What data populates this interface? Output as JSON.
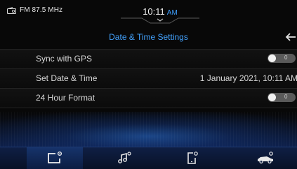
{
  "status_bar": {
    "radio_label": "FM 87.5 MHz",
    "time": "10:11",
    "ampm": "AM"
  },
  "header": {
    "title": "Date & Time Settings"
  },
  "settings": {
    "rows": [
      {
        "label": "Sync with GPS",
        "type": "toggle",
        "state": "0"
      },
      {
        "label": "Set Date & Time",
        "type": "value",
        "value": "1 January 2021, 10:11 AM"
      },
      {
        "label": "24 Hour Format",
        "type": "toggle",
        "state": "0"
      }
    ]
  },
  "bottom_nav": {
    "items": [
      {
        "icon": "settings-display-icon",
        "active": true
      },
      {
        "icon": "music-icon",
        "active": false
      },
      {
        "icon": "phone-icon",
        "active": false
      },
      {
        "icon": "car-icon",
        "active": false
      }
    ]
  },
  "colors": {
    "accent": "#43a3ff",
    "background": "#080808",
    "toggle_off": "#5a5a5a",
    "nav_background": "#0f1f45"
  }
}
